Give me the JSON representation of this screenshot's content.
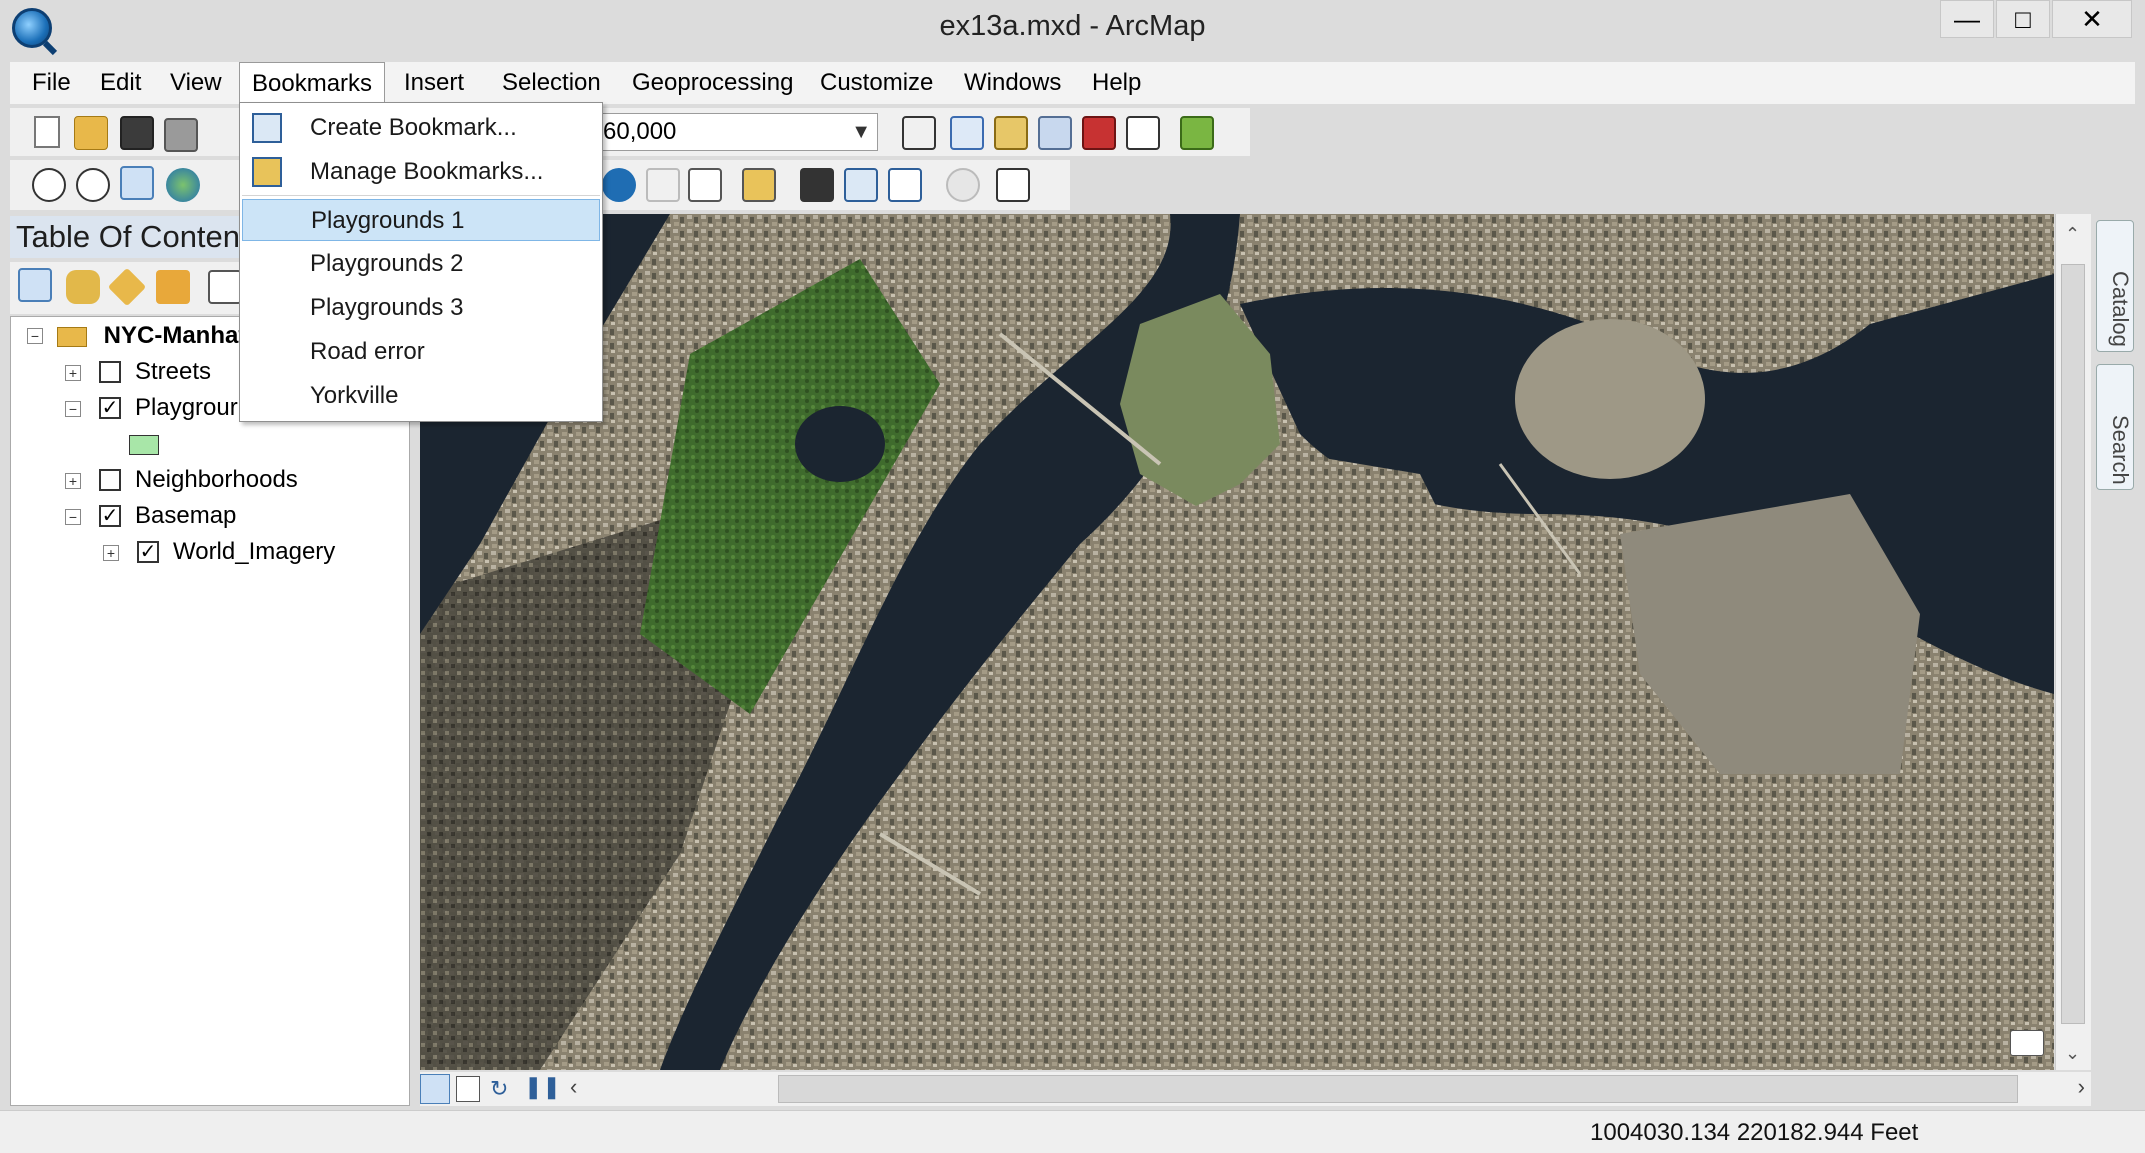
{
  "window": {
    "title": "ex13a.mxd - ArcMap",
    "minimize": "—",
    "maximize": "□",
    "close": "✕"
  },
  "menubar": {
    "items": [
      "File",
      "Edit",
      "View",
      "Bookmarks",
      "Insert",
      "Selection",
      "Geoprocessing",
      "Customize",
      "Windows",
      "Help"
    ],
    "open_menu": "Bookmarks"
  },
  "bookmarks_menu": {
    "create": "Create Bookmark...",
    "manage": "Manage Bookmarks...",
    "bookmarks": [
      "Playgrounds 1",
      "Playgrounds 2",
      "Playgrounds 3",
      "Road error",
      "Yorkville"
    ],
    "highlighted": "Playgrounds 1"
  },
  "toolbar": {
    "scale_value": "60,000"
  },
  "toc": {
    "title": "Table Of Content",
    "data_frame": "NYC-Manhat",
    "layers": [
      {
        "name": "Streets",
        "checked": false,
        "expanded": false
      },
      {
        "name": "Playgrour",
        "checked": true,
        "expanded": true
      },
      {
        "name": "Neighborhoods",
        "checked": false,
        "expanded": false
      },
      {
        "name": "Basemap",
        "checked": true,
        "expanded": true
      },
      {
        "name": "World_Imagery",
        "checked": true,
        "expanded": false
      }
    ],
    "playground_symbol_color": "#a8e6a8"
  },
  "side_panel": {
    "catalog": "Catalog",
    "search": "Search"
  },
  "status": {
    "coordinates": "1004030.134  220182.944 Feet"
  },
  "colors": {
    "menu_hover": "#cce4f7",
    "toc_header": "#dbe4ef",
    "water": "#1b2530",
    "park": "#3f6b2d"
  },
  "icons": [
    "new-document-icon",
    "open-folder-icon",
    "save-icon",
    "print-icon",
    "zoom-in-icon",
    "zoom-out-icon",
    "pan-icon",
    "full-extent-icon",
    "identify-icon",
    "find-icon",
    "go-to-xy-icon",
    "measure-icon",
    "bookmark-create-icon",
    "bookmark-manage-icon"
  ]
}
